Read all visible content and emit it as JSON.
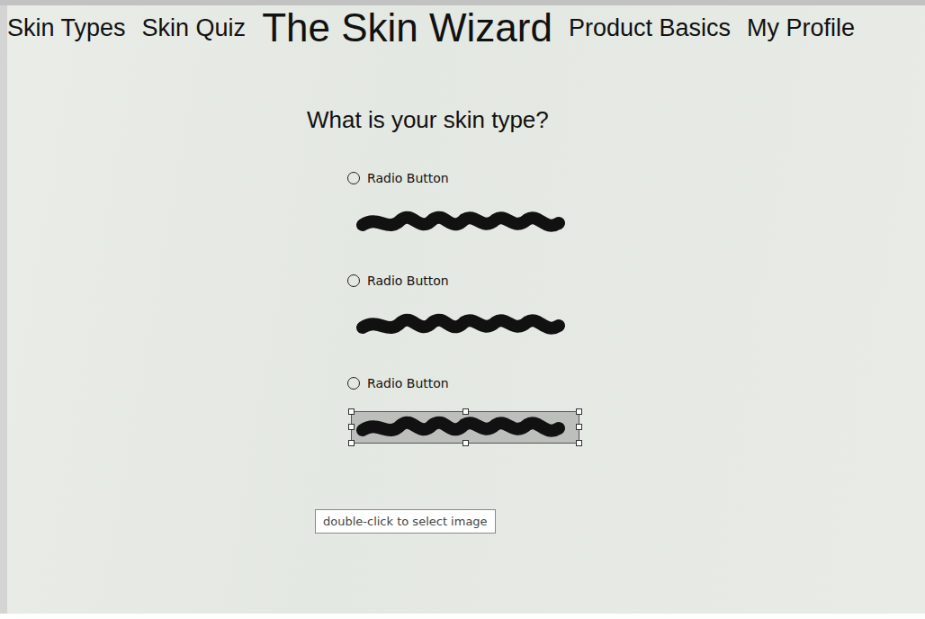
{
  "nav": {
    "left": [
      {
        "label": "Skin Types"
      },
      {
        "label": "Skin Quiz"
      }
    ],
    "title": "The Skin Wizard",
    "right": [
      {
        "label": "Product Basics"
      },
      {
        "label": "My Profile"
      }
    ]
  },
  "question": "What is your skin type?",
  "options": [
    {
      "label": "Radio Button",
      "selected": false,
      "image_selected": false
    },
    {
      "label": "Radio Button",
      "selected": false,
      "image_selected": false
    },
    {
      "label": "Radio Button",
      "selected": false,
      "image_selected": true
    }
  ],
  "tooltip": "double-click to select image"
}
